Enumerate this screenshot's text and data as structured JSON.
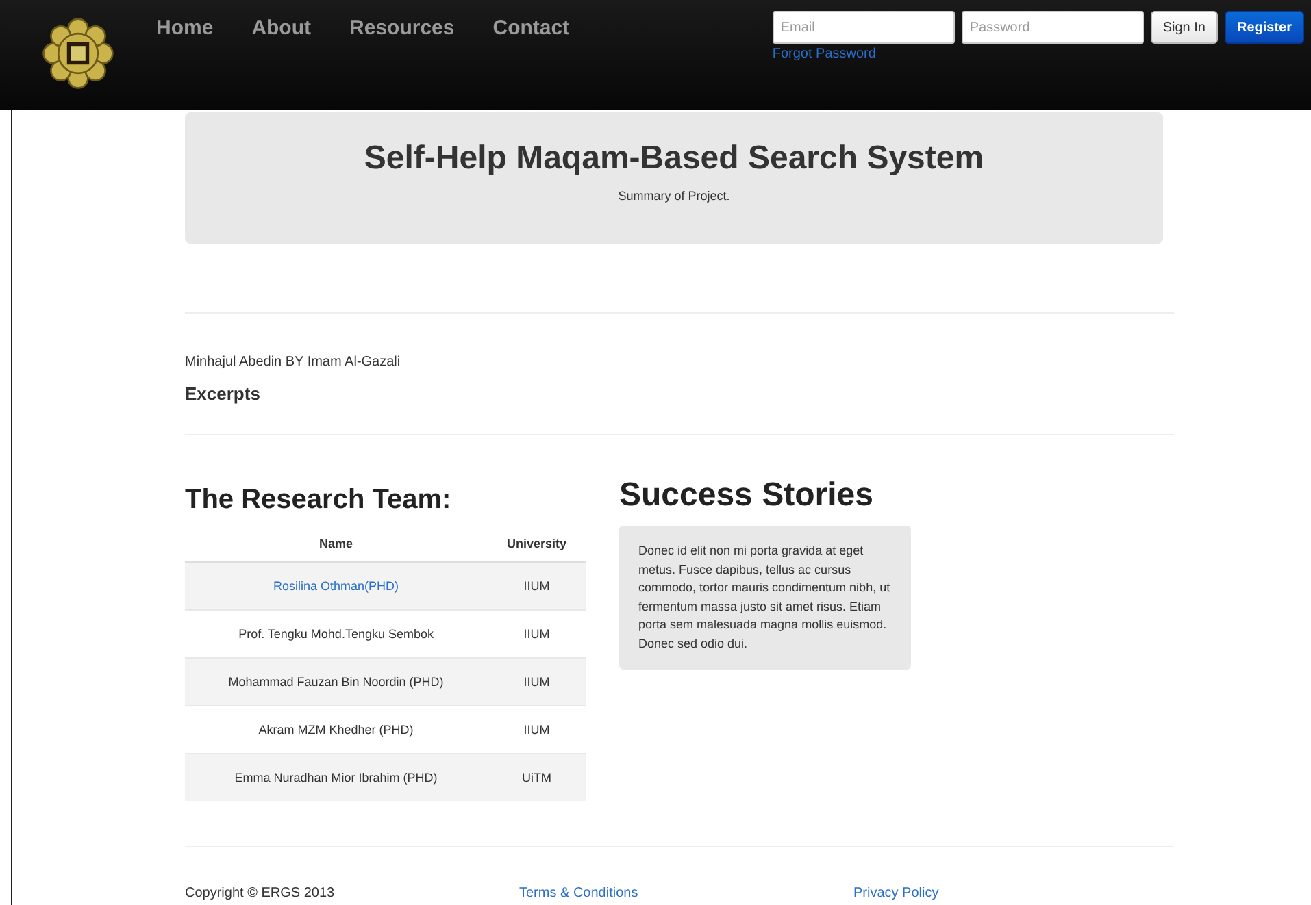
{
  "navbar": {
    "menu": [
      {
        "label": "Home"
      },
      {
        "label": "About"
      },
      {
        "label": "Resources"
      },
      {
        "label": "Contact"
      }
    ],
    "login": {
      "email": {
        "placeholder": "Email"
      },
      "password": {
        "placeholder": "Password"
      },
      "forgot": "Forgot Password",
      "buttons": [
        {
          "label": "Sign In",
          "kind": "default"
        },
        {
          "label": "Register",
          "kind": "primary"
        }
      ]
    }
  },
  "hero": {
    "title": "Self-Help Maqam-Based Search System",
    "subtitle": "Summary of Project."
  },
  "book": {
    "line": "Minhajul Abedin BY Imam Al-Gazali",
    "heading": "Excerpts"
  },
  "team": {
    "title": "The Research Team:",
    "columns": [
      "Name",
      "University"
    ],
    "rows": [
      {
        "name": "Rosilina Othman(PHD)",
        "link": true,
        "university": "IIUM"
      },
      {
        "name": "Prof. Tengku Mohd.Tengku Sembok",
        "link": false,
        "university": "IIUM"
      },
      {
        "name": "Mohammad Fauzan Bin Noordin (PHD)",
        "link": false,
        "university": "IIUM"
      },
      {
        "name": "Akram MZM Khedher (PHD)",
        "link": false,
        "university": "IIUM"
      },
      {
        "name": "Emma Nuradhan Mior Ibrahim (PHD)",
        "link": false,
        "university": "UiTM"
      }
    ]
  },
  "stories": {
    "title": "Success Stories",
    "text": "Donec id elit non mi porta gravida at eget metus. Fusce dapibus, tellus ac cursus commodo, tortor mauris condimentum nibh, ut fermentum massa justo sit amet risus. Etiam porta sem malesuada magna mollis euismod. Donec sed odio dui."
  },
  "footer": {
    "copyright": "Copyright © ERGS 2013",
    "links": [
      "Terms & Conditions",
      "Privacy Policy"
    ]
  }
}
